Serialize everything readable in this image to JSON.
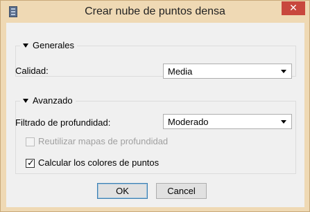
{
  "window": {
    "title": "Crear nube de puntos densa",
    "close_glyph": "✕",
    "icon": "film-icon"
  },
  "general_group": {
    "title": "Generales",
    "quality_label": "Calidad:",
    "quality_value": "Media"
  },
  "advanced_group": {
    "title": "Avanzado",
    "depth_filter_label": "Filtrado de profundidad:",
    "depth_filter_value": "Moderado",
    "reuse_depth_maps": {
      "label": "Reutilizar mapas de profundidad",
      "checked": false,
      "enabled": false
    },
    "calc_point_colors": {
      "label": "Calcular los colores de puntos",
      "checked": true,
      "enabled": true
    }
  },
  "buttons": {
    "ok_label": "OK",
    "cancel_label": "Cancel"
  },
  "colors": {
    "title_bar": "#efd9b4",
    "close_button": "#c8473d",
    "client": "#f0f0f0"
  }
}
